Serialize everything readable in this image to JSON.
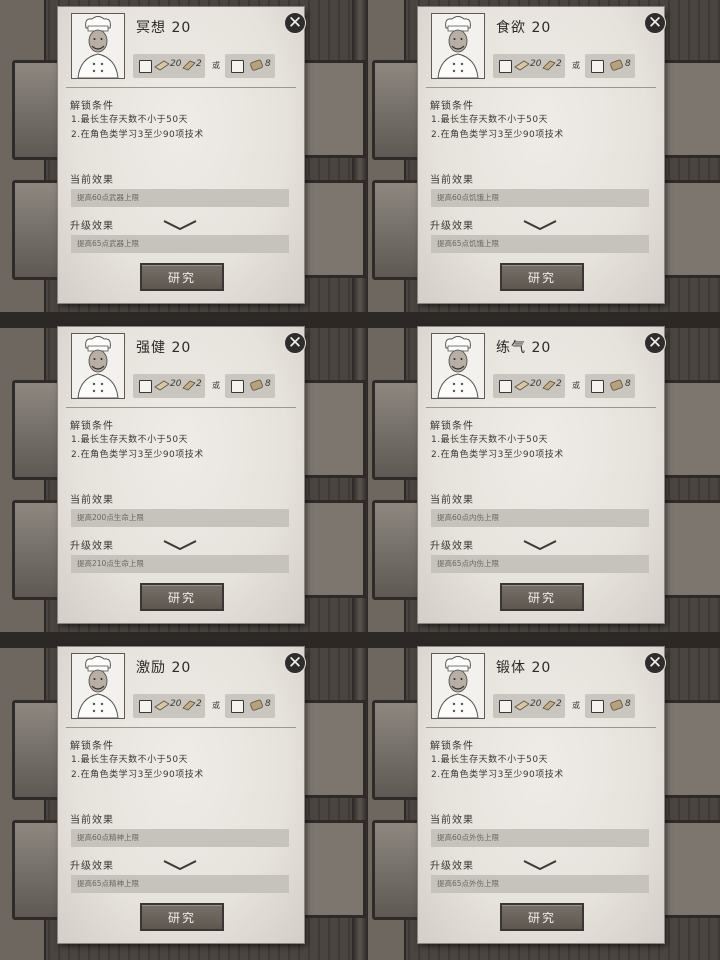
{
  "button_label": "研究",
  "close_symbol": "✕",
  "or_label": "或",
  "labels": {
    "unlock": "解锁条件",
    "current": "当前效果",
    "upgrade": "升级效果"
  },
  "conditions": [
    "1.最长生存天数不小于50天",
    "2.在角色类学习3至少90项技术"
  ],
  "cost": {
    "paper": "20",
    "scroll_count": "2",
    "alt_count": "8"
  },
  "cards": [
    {
      "title": "冥想 20",
      "current": "提高60点武器上限",
      "upgrade": "提高65点武器上限"
    },
    {
      "title": "食欲 20",
      "current": "提高60点饥饿上限",
      "upgrade": "提高65点饥饿上限"
    },
    {
      "title": "强健 20",
      "current": "提高200点生命上限",
      "upgrade": "提高210点生命上限"
    },
    {
      "title": "练气 20",
      "current": "提高60点内伤上限",
      "upgrade": "提高65点内伤上限"
    },
    {
      "title": "激励 20",
      "current": "提高60点精神上限",
      "upgrade": "提高65点精神上限"
    },
    {
      "title": "锻体 20",
      "current": "提高60点外伤上限",
      "upgrade": "提高65点外伤上限"
    }
  ],
  "colors": {
    "dialog_bg": "#e6e2dc",
    "button_bg": "#6a645e",
    "bar_bg": "#c6c2bc",
    "background": "#3a3633"
  }
}
